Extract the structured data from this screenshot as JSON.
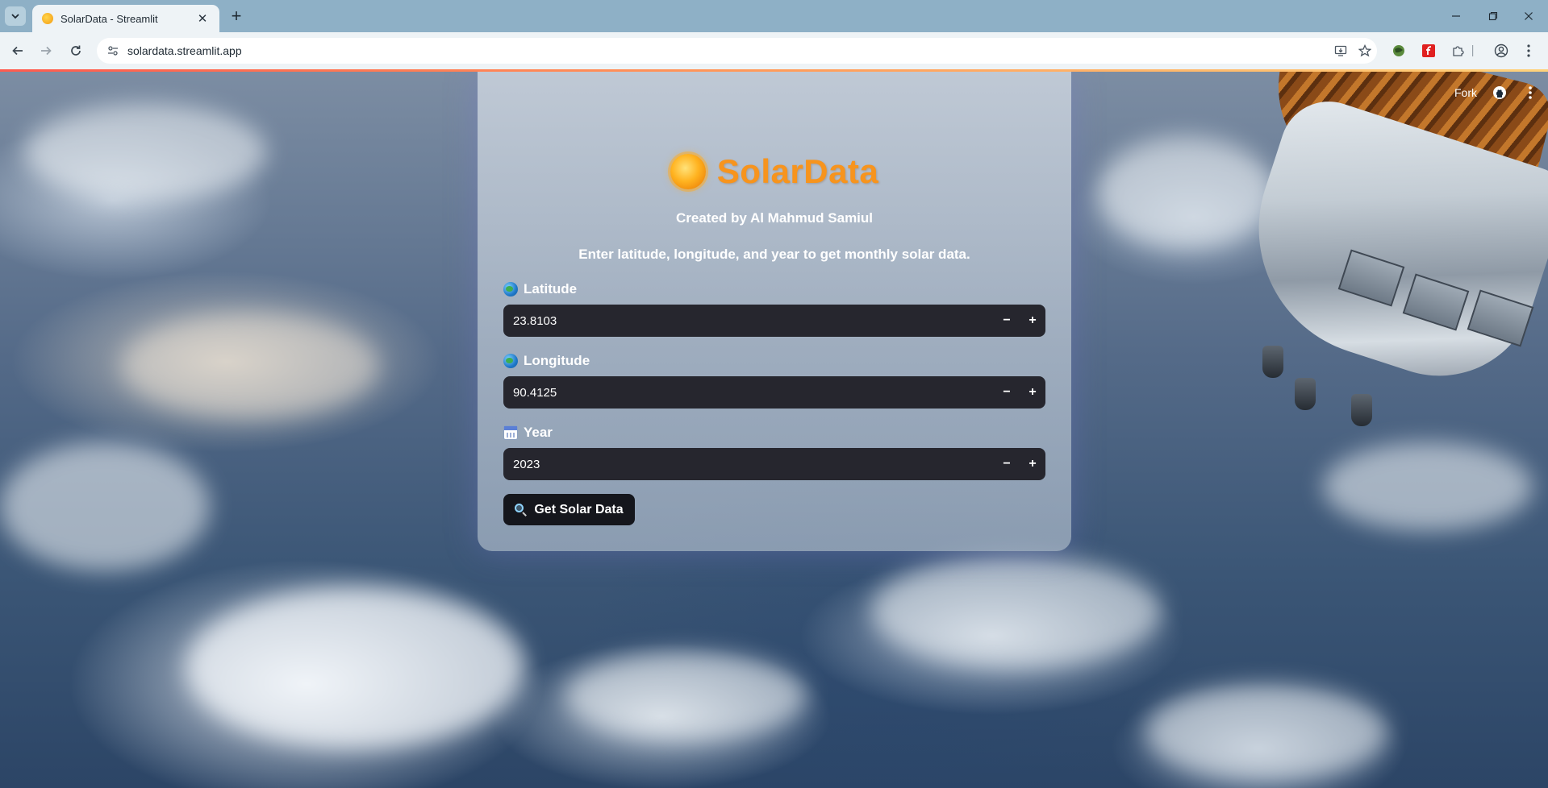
{
  "browser": {
    "tab_title": "SolarData - Streamlit",
    "tab_close": "✕",
    "new_tab": "+",
    "url": "solardata.streamlit.app"
  },
  "header": {
    "fork_label": "Fork"
  },
  "app": {
    "title": "SolarData",
    "author": "Created by Al Mahmud Samiul",
    "subtitle": "Enter latitude, longitude, and year to get monthly solar data.",
    "fields": [
      {
        "label": "Latitude",
        "value": "23.8103",
        "icon": "globe-icon"
      },
      {
        "label": "Longitude",
        "value": "90.4125",
        "icon": "globe-icon"
      },
      {
        "label": "Year",
        "value": "2023",
        "icon": "calendar-icon"
      }
    ],
    "stepper": {
      "minus": "−",
      "plus": "+"
    },
    "submit_label": "Get Solar Data",
    "colors": {
      "title": "#f7941d",
      "input_bg": "#26262e",
      "button_bg": "#15161c"
    }
  }
}
